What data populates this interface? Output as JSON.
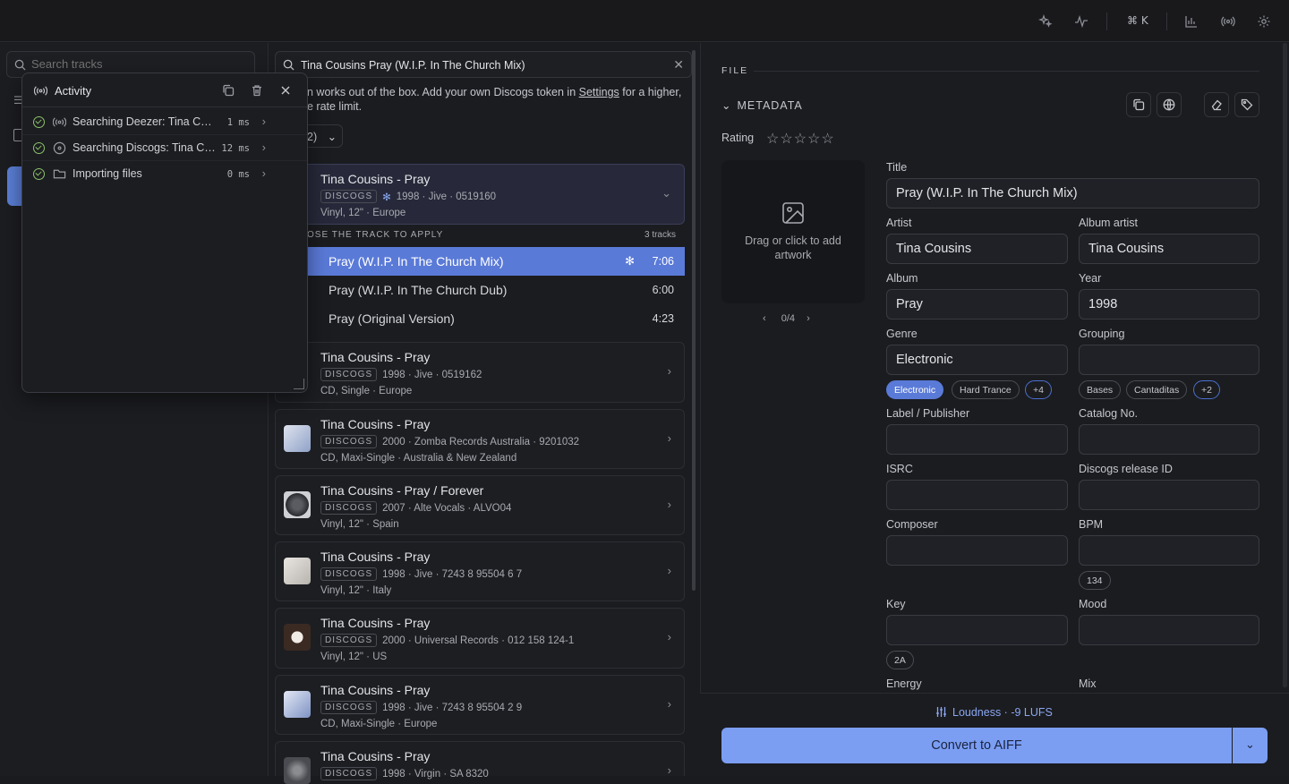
{
  "topbar": {
    "shortcut": "⌘ K"
  },
  "left": {
    "search_placeholder": "Search tracks"
  },
  "activity": {
    "title": "Activity",
    "rows": [
      {
        "text": "Searching Deezer: Tina Cousins Pray (W.I.P. In The Church Mix)",
        "ms": "1 ms"
      },
      {
        "text": "Searching Discogs: Tina Cousins Pray (W.I.P. In The Church Mix)",
        "ms": "12 ms"
      },
      {
        "text": "Importing files",
        "ms": "0 ms"
      }
    ]
  },
  "middle": {
    "search_value": "Tina Cousins Pray (W.I.P. In The Church Mix)",
    "info_prefix": "n works out of the box. Add your own Discogs token in ",
    "info_link": "Settings",
    "info_suffix": " for a higher,",
    "info_line2": "e rate limit.",
    "dropdown_label": "2)",
    "apply_header": "OSE THE TRACK TO APPLY",
    "apply_count": "3 tracks",
    "tracks": [
      {
        "name": "Pray (W.I.P. In The Church Mix)",
        "duration": "7:06"
      },
      {
        "name": "Pray (W.I.P. In The Church Dub)",
        "duration": "6:00"
      },
      {
        "name": "Pray (Original Version)",
        "duration": "4:23"
      }
    ],
    "source_badge": "DISCOGS",
    "results": [
      {
        "title": "Tina Cousins - Pray",
        "meta": "1998 · Jive · 0519160",
        "sub": "Vinyl, 12\" · Europe"
      },
      {
        "title": "Tina Cousins - Pray",
        "meta": "1998 · Jive · 0519162",
        "sub": "CD, Single · Europe"
      },
      {
        "title": "Tina Cousins - Pray",
        "meta": "2000 · Zomba Records Australia · 9201032",
        "sub": "CD, Maxi-Single · Australia & New Zealand"
      },
      {
        "title": "Tina Cousins - Pray / Forever",
        "meta": "2007 · Alte Vocals · ALVO04",
        "sub": "Vinyl, 12\" · Spain"
      },
      {
        "title": "Tina Cousins - Pray",
        "meta": "1998 · Jive · 7243 8 95504 6 7",
        "sub": "Vinyl, 12\" · Italy"
      },
      {
        "title": "Tina Cousins - Pray",
        "meta": "2000 · Universal Records · 012 158 124-1",
        "sub": "Vinyl, 12\" · US"
      },
      {
        "title": "Tina Cousins - Pray",
        "meta": "1998 · Jive · 7243 8 95504 2 9",
        "sub": "CD, Maxi-Single · Europe"
      },
      {
        "title": "Tina Cousins - Pray",
        "meta": "1998 · Virgin · SA 8320",
        "sub": ""
      }
    ]
  },
  "right": {
    "file_header": "FILE",
    "metadata_header": "METADATA",
    "rating_label": "Rating",
    "stars": "☆☆☆☆☆",
    "artwork_text": "Drag or click to add artwork",
    "artwork_pager": "0/4",
    "fields": {
      "title": {
        "label": "Title",
        "value": "Pray (W.I.P. In The Church Mix)"
      },
      "artist": {
        "label": "Artist",
        "value": "Tina Cousins"
      },
      "album_artist": {
        "label": "Album artist",
        "value": "Tina Cousins"
      },
      "album": {
        "label": "Album",
        "value": "Pray"
      },
      "year": {
        "label": "Year",
        "value": "1998"
      },
      "genre": {
        "label": "Genre",
        "value": "Electronic"
      },
      "grouping": {
        "label": "Grouping",
        "value": ""
      },
      "label": {
        "label": "Label / Publisher",
        "value": ""
      },
      "catalog": {
        "label": "Catalog No.",
        "value": ""
      },
      "isrc": {
        "label": "ISRC",
        "value": ""
      },
      "discogs_id": {
        "label": "Discogs release ID",
        "value": ""
      },
      "composer": {
        "label": "Composer",
        "value": ""
      },
      "bpm": {
        "label": "BPM",
        "value": ""
      },
      "key": {
        "label": "Key",
        "value": ""
      },
      "mood": {
        "label": "Mood",
        "value": ""
      },
      "energy": {
        "label": "Energy"
      },
      "mix": {
        "label": "Mix"
      }
    },
    "genre_pills": [
      "Electronic",
      "Hard Trance",
      "+4"
    ],
    "grouping_pills": [
      "Bases",
      "Cantaditas",
      "+2"
    ],
    "bpm_suggestion": "134",
    "key_suggestion": "2A",
    "loudness": "Loudness · -9 LUFS",
    "convert_label": "Convert to AIFF"
  }
}
